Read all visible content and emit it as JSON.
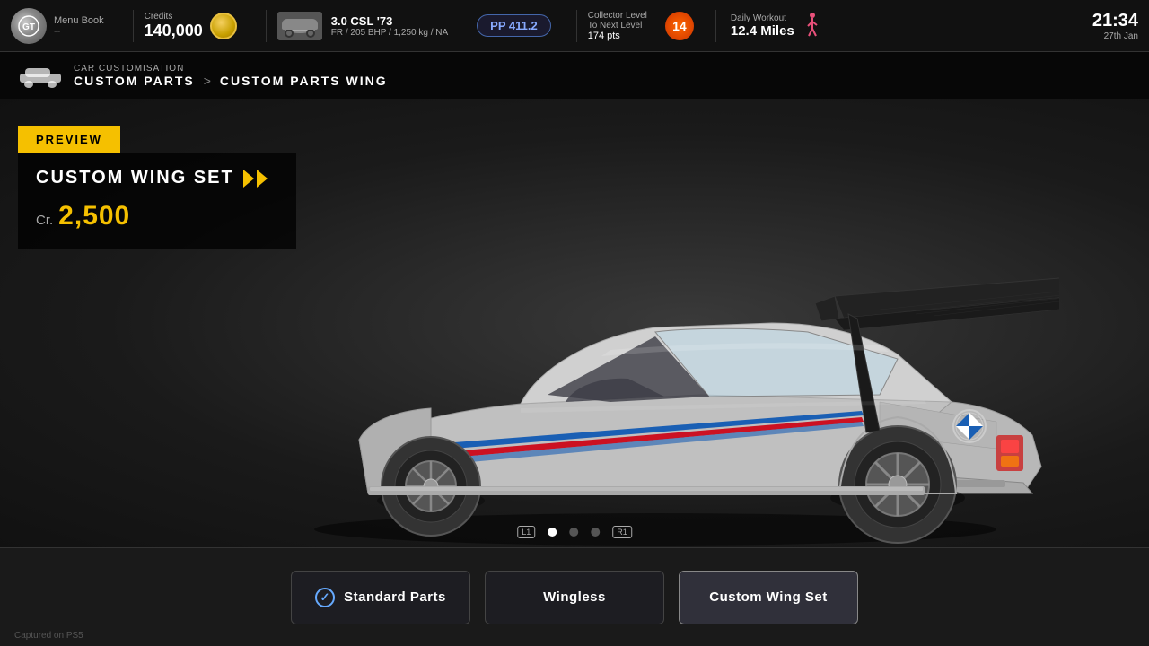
{
  "topbar": {
    "logo": "GT",
    "menu_book_label": "Menu Book",
    "menu_book_sub": "--",
    "credits_label": "Credits",
    "credits_value": "140,000",
    "car_name": "3.0 CSL '73",
    "car_specs": "FR / 205 BHP / 1,250 kg / NA",
    "pp_label": "PP 411.2",
    "collector_label": "Collector Level",
    "collector_next": "To Next Level",
    "collector_pts": "174 pts",
    "collector_level": "14",
    "daily_label": "Daily Workout",
    "daily_miles": "12.4 Miles",
    "time": "21:34",
    "date": "27th Jan"
  },
  "breadcrumb": {
    "section_label": "CAR CUSTOMISATION",
    "parts_label": "CUSTOM PARTS",
    "separator": ">",
    "wing_label": "CUSTOM PARTS WING"
  },
  "preview": {
    "badge": "PREVIEW",
    "name": "CUSTOM WING SET",
    "price_cr": "Cr.",
    "price_amount": "2,500"
  },
  "carousel": {
    "dots": [
      {
        "active": true
      },
      {
        "active": false
      },
      {
        "active": false
      }
    ],
    "left_trigger": "L1",
    "right_trigger": "R1"
  },
  "bottom_buttons": [
    {
      "label": "Standard Parts",
      "has_check": true,
      "active": false
    },
    {
      "label": "Wingless",
      "has_check": false,
      "active": false
    },
    {
      "label": "Custom Wing Set",
      "has_check": false,
      "active": true
    }
  ],
  "captured": "Captured on PS5"
}
